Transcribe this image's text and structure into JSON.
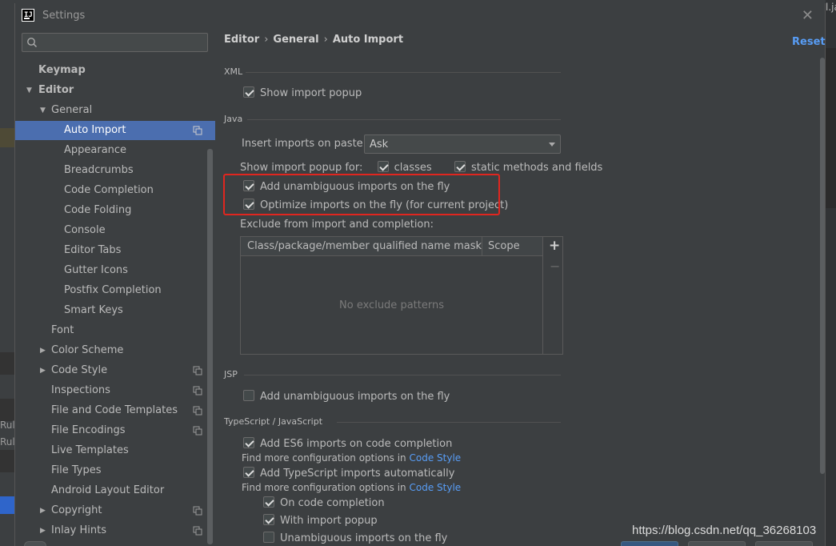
{
  "background": {
    "left_texts": [
      "Rul",
      "Rul"
    ],
    "right_text": "l.ja"
  },
  "window": {
    "title": "Settings",
    "app_icon": "intellij-logo",
    "close_icon": "close-icon"
  },
  "search": {
    "placeholder": ""
  },
  "sidebar": {
    "items": [
      {
        "label": "Keymap",
        "bold": true
      },
      {
        "label": "Editor",
        "bold": true,
        "expanded": true
      },
      {
        "label": "General",
        "expanded": true
      },
      {
        "label": "Auto Import",
        "selected": true,
        "copy_icon": true
      },
      {
        "label": "Appearance"
      },
      {
        "label": "Breadcrumbs"
      },
      {
        "label": "Code Completion"
      },
      {
        "label": "Code Folding"
      },
      {
        "label": "Console"
      },
      {
        "label": "Editor Tabs"
      },
      {
        "label": "Gutter Icons"
      },
      {
        "label": "Postfix Completion"
      },
      {
        "label": "Smart Keys"
      },
      {
        "label": "Font"
      },
      {
        "label": "Color Scheme",
        "collapsed": true
      },
      {
        "label": "Code Style",
        "collapsed": true,
        "copy_icon": true
      },
      {
        "label": "Inspections",
        "copy_icon": true
      },
      {
        "label": "File and Code Templates",
        "copy_icon": true
      },
      {
        "label": "File Encodings",
        "copy_icon": true
      },
      {
        "label": "Live Templates"
      },
      {
        "label": "File Types"
      },
      {
        "label": "Android Layout Editor"
      },
      {
        "label": "Copyright",
        "collapsed": true,
        "copy_icon": true
      },
      {
        "label": "Inlay Hints",
        "collapsed": true,
        "copy_icon": true
      }
    ]
  },
  "breadcrumb": [
    "Editor",
    "General",
    "Auto Import"
  ],
  "reset_label": "Reset",
  "xml": {
    "title": "XML",
    "show_import_popup": {
      "label": "Show import popup",
      "checked": true
    }
  },
  "java": {
    "title": "Java",
    "insert_imports_label": "Insert imports on paste:",
    "insert_imports_value": "Ask",
    "show_popup_for_label": "Show import popup for:",
    "classes": {
      "label": "classes",
      "checked": true
    },
    "static_methods": {
      "label": "static methods and fields",
      "checked": true
    },
    "add_unambiguous": {
      "label": "Add unambiguous imports on the fly",
      "checked": true
    },
    "optimize_imports": {
      "label": "Optimize imports on the fly (for current project)",
      "checked": true
    },
    "exclude_label": "Exclude from import and completion:",
    "table_headers": [
      "Class/package/member qualified name mask",
      "Scope"
    ],
    "empty_text": "No exclude patterns",
    "add_symbol": "+",
    "remove_symbol": "−"
  },
  "jsp": {
    "title": "JSP",
    "add_unambiguous": {
      "label": "Add unambiguous imports on the fly",
      "checked": false
    }
  },
  "ts": {
    "title": "TypeScript / JavaScript",
    "add_es6": {
      "label": "Add ES6 imports on code completion",
      "checked": true
    },
    "find_more_1": "Find more configuration options in",
    "code_style_link_1": "Code Style",
    "add_ts": {
      "label": "Add TypeScript imports automatically",
      "checked": true
    },
    "find_more_2": "Find more configuration options in",
    "code_style_link_2": "Code Style",
    "on_completion": {
      "label": "On code completion",
      "checked": true
    },
    "with_popup": {
      "label": "With import popup",
      "checked": true
    },
    "unambiguous_partial": {
      "label": "Unambiguous imports on the fly",
      "checked": false
    }
  },
  "watermark": "https://blog.csdn.net/qq_36268103"
}
